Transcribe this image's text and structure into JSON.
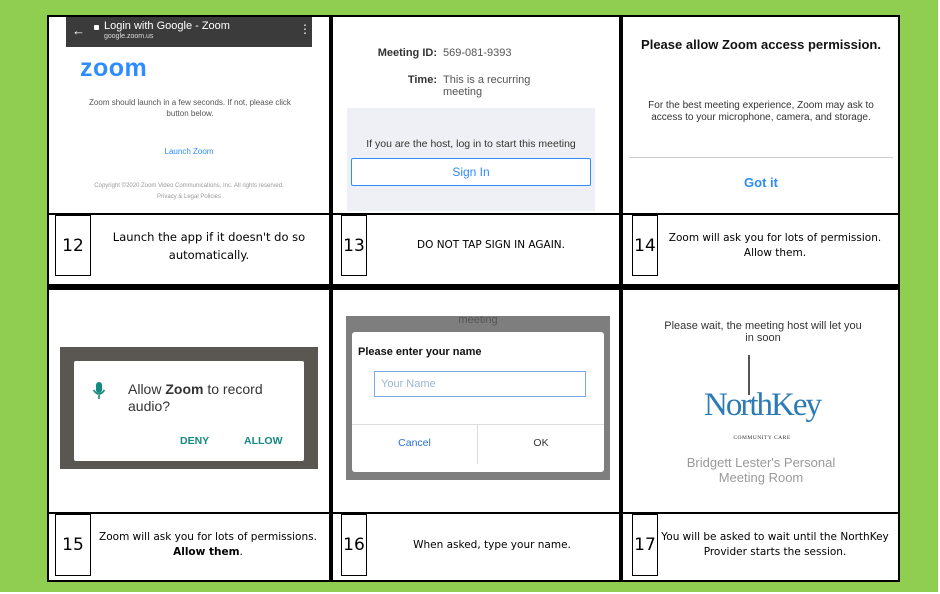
{
  "panel12": {
    "browser_title": "Login with Google - Zoom",
    "browser_url": "google.zoom.us",
    "logo": "zoom",
    "message": "Zoom should launch in a few seconds. If not, please click button below.",
    "launch_link": "Launch Zoom",
    "copyright": "Copyright ©2020 Zoom Video Communications, Inc. All rights reserved.",
    "privacy": "Privacy & Legal Policies"
  },
  "panel13": {
    "meeting_id_label": "Meeting ID:",
    "meeting_id_value": "569-081-9393",
    "time_label": "Time:",
    "time_value": "This is a recurring meeting",
    "host_text": "If you are the host, log in to start this meeting",
    "sign_in": "Sign In"
  },
  "panel14": {
    "title": "Please allow Zoom access permission.",
    "body": "For the best meeting experience, Zoom may ask to access to your microphone, camera, and storage.",
    "button": "Got it"
  },
  "panel15": {
    "prompt_prefix": "Allow ",
    "prompt_app": "Zoom",
    "prompt_suffix": " to record audio?",
    "deny": "DENY",
    "allow": "ALLOW"
  },
  "panel16": {
    "header": "meeting",
    "title": "Please enter your name",
    "placeholder": "Your Name",
    "cancel": "Cancel",
    "ok": "OK"
  },
  "panel17": {
    "wait_text": "Please wait, the meeting host will let you in soon",
    "logo_text": "NorthKey",
    "logo_sub": "COMMUNITY CARE",
    "room": "Bridgett Lester's Personal Meeting Room"
  },
  "steps": [
    {
      "number": "12",
      "text": "Launch the app if it doesn't do so automatically."
    },
    {
      "number": "13",
      "text": "DO NOT TAP SIGN IN AGAIN."
    },
    {
      "number": "14",
      "text": "Zoom will ask you for lots of permission. Allow them."
    },
    {
      "number": "15",
      "text_plain": "Zoom will ask you for lots of permissions.",
      "text_bold": "Allow them",
      "text_end": "."
    },
    {
      "number": "16",
      "text": "When asked, type your name."
    },
    {
      "number": "17",
      "text": "You will be asked to wait until the NorthKey Provider starts the session."
    }
  ],
  "colors": {
    "background_green": "#90ce52",
    "zoom_blue": "#2d8cff",
    "android_teal": "#14897f"
  }
}
